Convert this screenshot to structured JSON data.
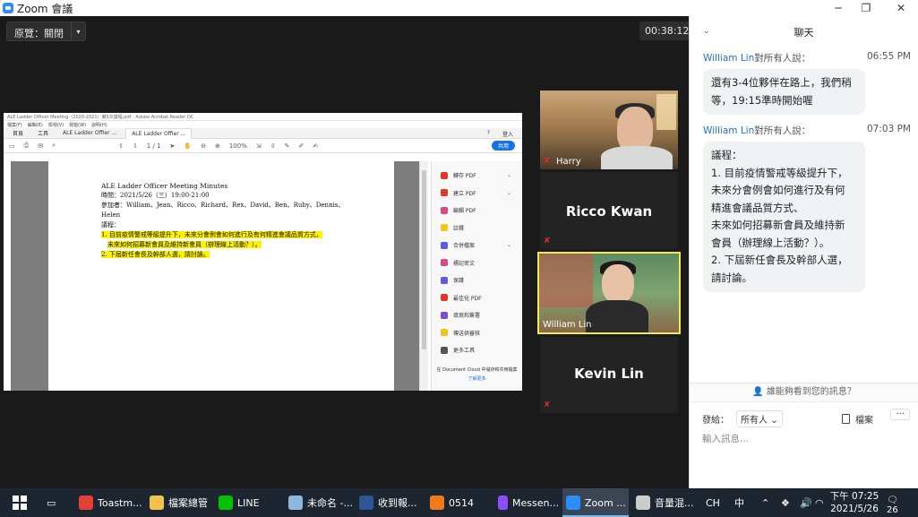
{
  "window": {
    "title": "Zoom 會議",
    "minimize": "─",
    "restore": "❐",
    "close": "✕"
  },
  "meeting": {
    "view_label": "原覽：關閉",
    "view_arrow": "▾",
    "timer": "00:38:12"
  },
  "shared_doc": {
    "app_title": "ALE Ladder Officer Meeting（2020-2021）第5次議程.pdf - Adobe Acrobat Reader DC",
    "menu": [
      "檔案(F)",
      "編輯(E)",
      "檢視(V)",
      "視窗(W)",
      "說明(H)"
    ],
    "tabs": [
      "首頁",
      "工具",
      "ALE Ladder Offier ...",
      "ALE Ladder Offier ..."
    ],
    "tab_right": [
      "?",
      "登入"
    ],
    "page_num": "1 / 1",
    "zoom": "100%",
    "share_btn": "共用",
    "title": "ALE Ladder Officer Meeting Minutes",
    "time_line": "時間：2021/5/26（三）19:00-21:00",
    "attendees_line": "參加者：William、Jean、Ricco、Richard、Rex、David、Ben、Ruby、Dennis、",
    "attendees_line2": "Helen",
    "agenda_label": "議程：",
    "item1_line1": "1. 目前疫情警戒等級提升下，未來分會例會如何進行及有何精進會議品質方式，",
    "item1_line2": "未來如何招募新會員及維持新會員（辦理線上活動？）。",
    "item2": "2. 下屆新任會長及幹部人選，請討論。",
    "tools": [
      {
        "label": "轉存 PDF",
        "color": "#e0392b",
        "dropdown": true
      },
      {
        "label": "建立 PDF",
        "color": "#e0392b",
        "dropdown": true
      },
      {
        "label": "編輯 PDF",
        "color": "#d64a8c",
        "dropdown": false
      },
      {
        "label": "註釋",
        "color": "#f2c518",
        "dropdown": false
      },
      {
        "label": "合併檔案",
        "color": "#5c5ce0",
        "dropdown": true
      },
      {
        "label": "標記密文",
        "color": "#d64a8c",
        "dropdown": false
      },
      {
        "label": "保護",
        "color": "#5c5ce0",
        "dropdown": false
      },
      {
        "label": "最佳化 PDF",
        "color": "#e0392b",
        "dropdown": false
      },
      {
        "label": "填寫和簽署",
        "color": "#7a4bd6",
        "dropdown": false
      },
      {
        "label": "傳送供審核",
        "color": "#f2c518",
        "dropdown": false
      },
      {
        "label": "更多工具",
        "color": "#555555",
        "dropdown": false
      }
    ],
    "doc_cloud": "在 Document Cloud 中儲存和共用檔案",
    "learn_more": "了解更多"
  },
  "participants": [
    {
      "name": "Harry",
      "muted": true
    },
    {
      "name": "Ricco Kwan",
      "muted": true
    },
    {
      "name": "William Lin",
      "muted": false
    },
    {
      "name": "Kevin Lin",
      "muted": true
    }
  ],
  "chat": {
    "header": "聊天",
    "messages": [
      {
        "sender": "William Lin",
        "to": "對所有人說：",
        "time": "06:55 PM",
        "text": "還有3-4位夥伴在路上，我們稍等，19:15準時開始喔"
      },
      {
        "sender": "William Lin",
        "to": "對所有人說：",
        "time": "07:03 PM",
        "lines": [
          "議程：",
          "1. 目前疫情警戒等級提升下，",
          "未來分會例會如何進行及有何",
          "精進會議品質方式、",
          "未來如何招募新會員及維持新",
          "會員（辦理線上活動？）。",
          "2. 下屆新任會長及幹部人選，",
          "請討論。"
        ]
      }
    ],
    "who_can_see": "誰能夠看到您的訊息？",
    "send_to_label": "發給：",
    "send_to_value": "所有人",
    "file_label": "檔案",
    "more": "···",
    "input_placeholder": "輸入訊息..."
  },
  "taskbar": {
    "items": [
      {
        "label": "Toastm...",
        "color": "#e34133"
      },
      {
        "label": "檔案總管",
        "color": "#f2c14e"
      },
      {
        "label": "LINE",
        "color": "#00c300"
      },
      {
        "label": "未命名 -...",
        "color": "#8fb8e0"
      },
      {
        "label": "收到報...",
        "color": "#2b5797"
      },
      {
        "label": "0514",
        "color": "#f07a1a"
      },
      {
        "label": "Messen...",
        "color": "#8a4dff"
      },
      {
        "label": "Zoom ...",
        "color": "#2d8cff"
      },
      {
        "label": "音量混...",
        "color": "#cccccc"
      }
    ],
    "ime": "CH",
    "lang": "中",
    "time": "下午 07:25",
    "date": "2021/5/26",
    "notifications": "26"
  }
}
